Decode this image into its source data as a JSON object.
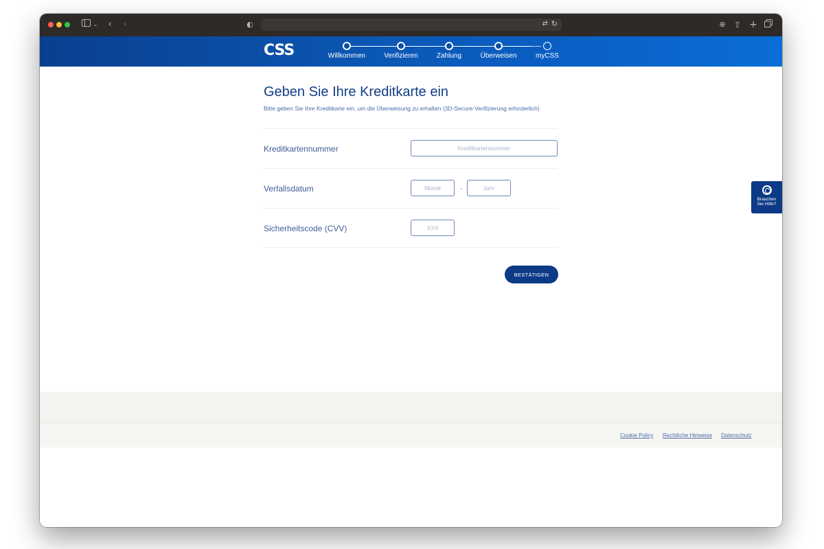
{
  "browser": {
    "chrome_icons": {
      "sidebar": "sidebar-icon",
      "back": "chevron-left-icon",
      "forward": "chevron-right-icon",
      "shield": "privacy-shield-icon",
      "translate": "translate-icon",
      "reload": "reload-icon",
      "download": "download-icon",
      "share": "share-icon",
      "new_tab": "plus-icon",
      "tabs": "tabs-overview-icon"
    }
  },
  "header": {
    "logo": "CSS",
    "steps": [
      {
        "label": "Willkommen",
        "state": "done"
      },
      {
        "label": "Verifizieren",
        "state": "done"
      },
      {
        "label": "Zahlung",
        "state": "done"
      },
      {
        "label": "Überweisen",
        "state": "done"
      },
      {
        "label": "myCSS",
        "state": "todo"
      }
    ]
  },
  "main": {
    "title": "Geben Sie Ihre Kreditkarte ein",
    "subtitle": "Bitte geben Sie Ihre Kreditkarte ein, um die Überweisung zu erhalten (3D-Secure-Verifizierung erforderlich)",
    "fields": {
      "card_number": {
        "label": "Kreditkartennummer",
        "placeholder": "Kreditkartennummer",
        "value": ""
      },
      "expiry": {
        "label": "Verfallsdatum",
        "month_placeholder": "Monat",
        "year_placeholder": "Jahr"
      },
      "cvv": {
        "label": "Sicherheitscode (CVV)",
        "placeholder": "XXX",
        "value": ""
      }
    },
    "confirm_label": "BESTÄTIGEN"
  },
  "help": {
    "icon": "lifebuoy-icon",
    "line1": "Brauchen",
    "line2": "Sie Hilfe?"
  },
  "footer": {
    "links": [
      "Cookie Policy",
      "Rechtliche Hinweise",
      "Datenschutz"
    ]
  },
  "colors": {
    "brand_blue": "#0c3a86",
    "header_gradient_start": "#0a3f8f",
    "header_gradient_end": "#0a6ed6",
    "text_blue": "#3e5d98"
  }
}
